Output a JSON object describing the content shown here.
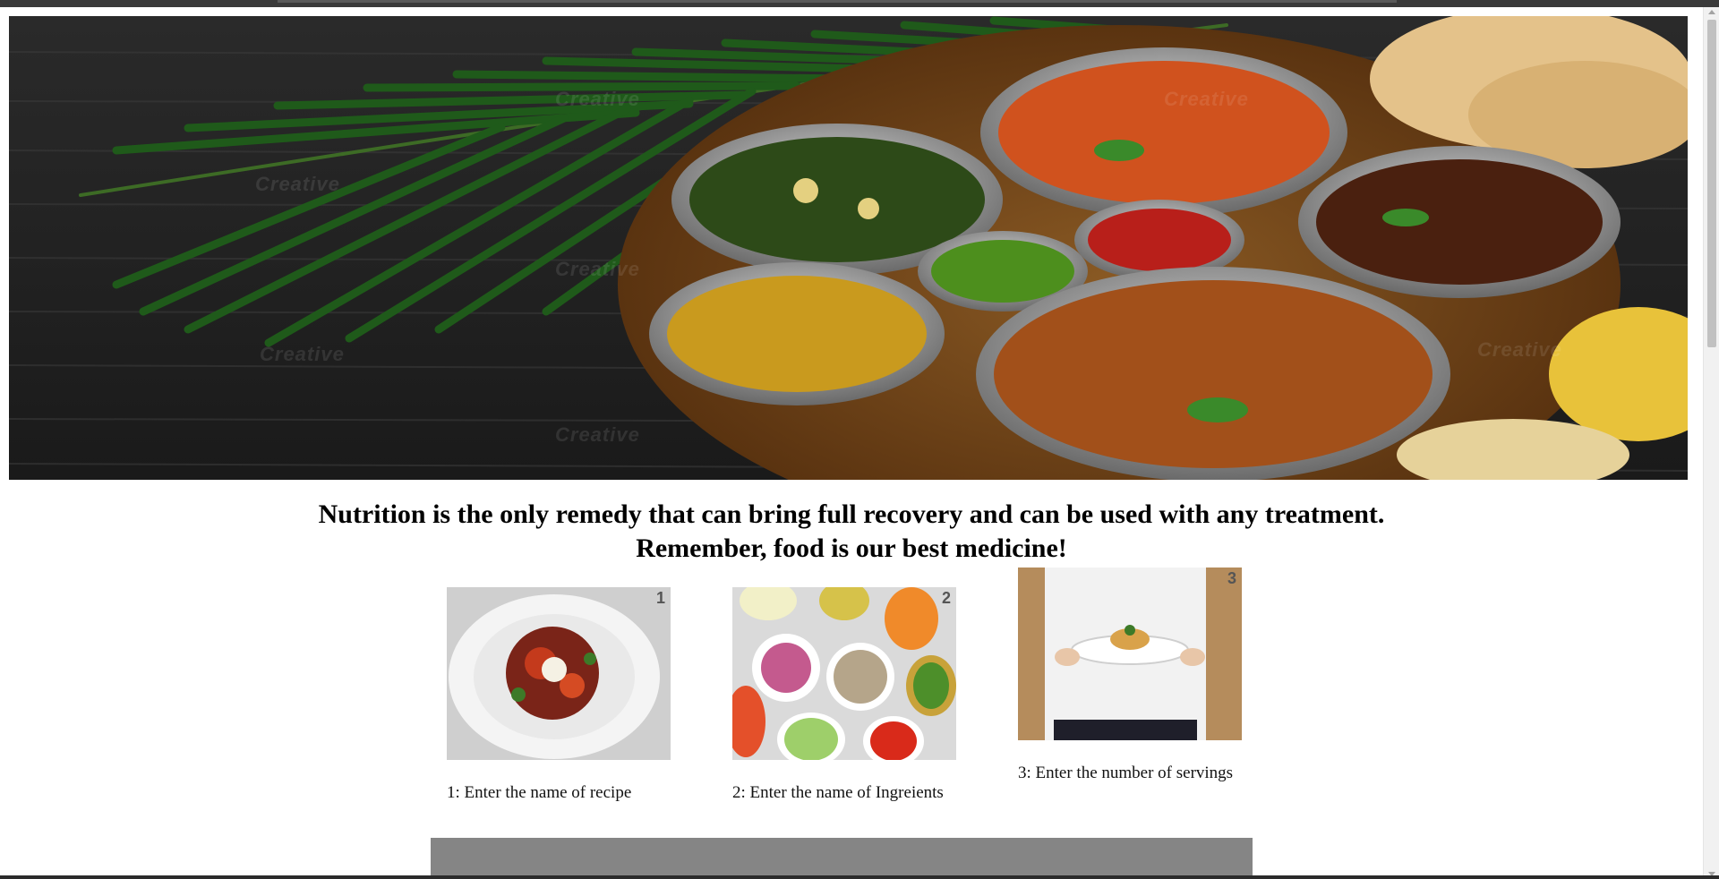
{
  "hero": {
    "alt": "Indian food thali banner",
    "watermark_text": "Creative"
  },
  "headline": {
    "line1": "Nutrition is the only remedy that can bring full recovery and can be used with any treatment.",
    "line2": "Remember, food is our best medicine!"
  },
  "steps": [
    {
      "number": "1",
      "caption": "1: Enter the name of recipe",
      "image_alt": "plated dish"
    },
    {
      "number": "2",
      "caption": "2: Enter the name of Ingreients",
      "image_alt": "ingredient bowls"
    },
    {
      "number": "3",
      "caption": "3: Enter the number of servings",
      "image_alt": "chef holding plate"
    }
  ],
  "colors": {
    "panel": "#858585",
    "text": "#000000"
  }
}
